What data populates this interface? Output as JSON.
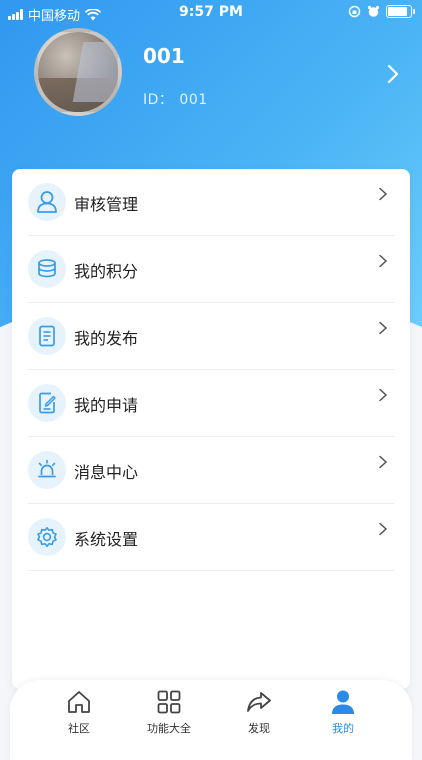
{
  "status_bar": {
    "carrier": "中国移动",
    "time": "9:57 PM"
  },
  "profile": {
    "name": "001",
    "id_label": "ID：",
    "id_value": "001"
  },
  "menu": [
    {
      "label": "审核管理",
      "icon": "user-icon"
    },
    {
      "label": "我的积分",
      "icon": "coins-stack-icon"
    },
    {
      "label": "我的发布",
      "icon": "document-icon"
    },
    {
      "label": "我的申请",
      "icon": "edit-document-icon"
    },
    {
      "label": "消息中心",
      "icon": "alarm-light-icon"
    },
    {
      "label": "系统设置",
      "icon": "gear-icon"
    }
  ],
  "tabbar": [
    {
      "label": "社区",
      "icon": "home-icon",
      "active": false
    },
    {
      "label": "功能大全",
      "icon": "grid-icon",
      "active": false
    },
    {
      "label": "发现",
      "icon": "share-arrow-icon",
      "active": false
    },
    {
      "label": "我的",
      "icon": "person-icon",
      "active": true
    }
  ],
  "colors": {
    "accent": "#2a8ae5",
    "header_start": "#2f98f0",
    "header_end": "#6fd0fb",
    "icon_bg": "#e6f3fd",
    "icon_stroke": "#3a9be8"
  }
}
